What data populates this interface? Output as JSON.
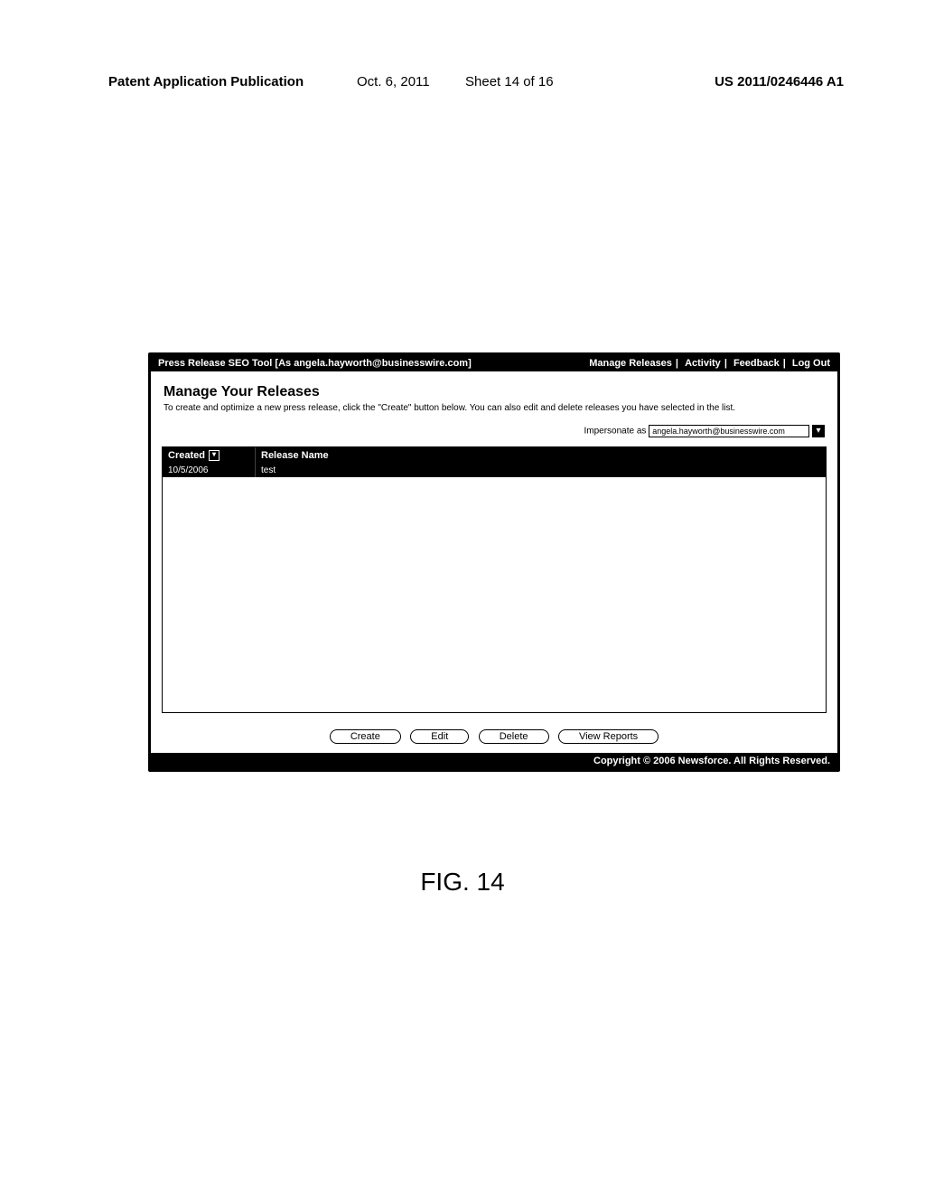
{
  "doc_header": {
    "publication": "Patent Application Publication",
    "date": "Oct. 6, 2011",
    "sheet": "Sheet 14 of 16",
    "pubno": "US 2011/0246446 A1"
  },
  "topbar": {
    "title": "Press Release SEO Tool [As angela.hayworth@businesswire.com]",
    "nav": {
      "manage": "Manage Releases",
      "activity": "Activity",
      "feedback": "Feedback",
      "logout": "Log Out"
    }
  },
  "section": {
    "title": "Manage Your Releases",
    "desc": "To create and optimize a new press release, click the \"Create\" button below. You can also edit and delete releases you have selected in the list."
  },
  "impersonate": {
    "label": "Impersonate as",
    "value": "angela.hayworth@businesswire.com"
  },
  "table": {
    "headers": {
      "created": "Created",
      "name": "Release Name"
    },
    "rows": [
      {
        "created": "10/5/2006",
        "name": "test"
      }
    ]
  },
  "buttons": {
    "create": "Create",
    "edit": "Edit",
    "delete": "Delete",
    "reports": "View Reports"
  },
  "footer": "Copyright © 2006 Newsforce. All Rights Reserved.",
  "figure_label": "FIG. 14"
}
